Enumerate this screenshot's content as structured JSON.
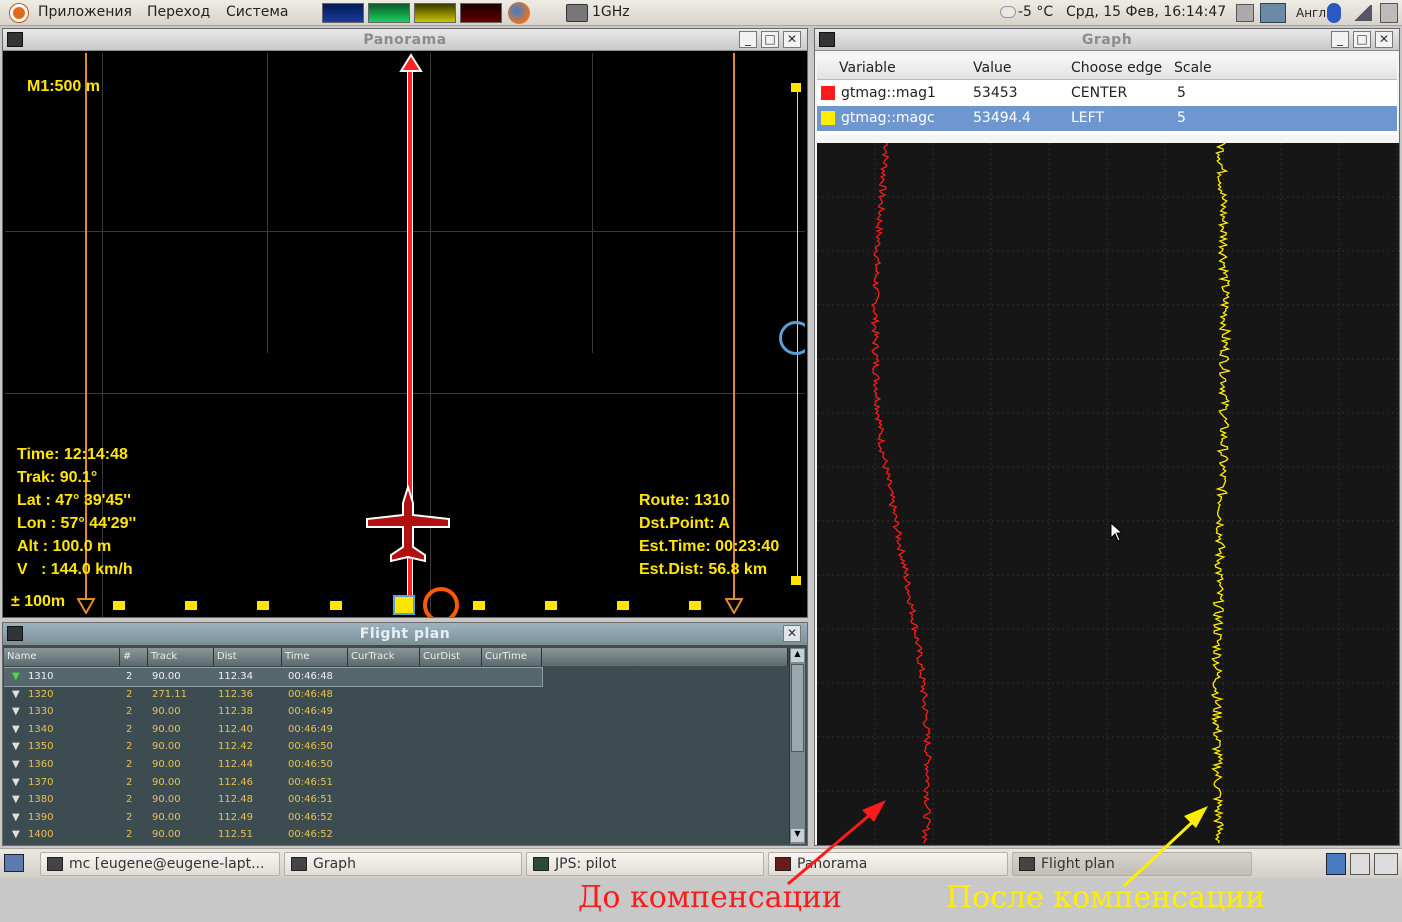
{
  "top_panel": {
    "menus": [
      "Приложения",
      "Переход",
      "Система"
    ],
    "cpu": "1GHz",
    "weather": "-5 °C",
    "clock": "Срд, 15 Фев, 16:14:47",
    "keyboard": "Англ"
  },
  "panorama": {
    "title": "Panorama",
    "scale": "M1:500 m",
    "range": "± 100m",
    "left_readout": [
      "Time: 12:14:48",
      "Trak: 90.1°",
      "Lat : 47° 39'45''",
      "Lon : 57° 44'29''",
      "Alt : 100.0 m",
      "V   : 144.0 km/h"
    ],
    "right_readout": [
      "Route: 1310",
      "Dst.Point: A",
      "Est.Time: 00:23:40",
      "Est.Dist: 56.8 km"
    ],
    "colors": {
      "hud": "#ffe600",
      "track": "#ff2020",
      "boundary": "#e08a2a"
    }
  },
  "flight_plan": {
    "title": "Flight plan",
    "columns": [
      "Name",
      "#",
      "Track",
      "Dist",
      "Time",
      "CurTrack",
      "CurDist",
      "CurTime"
    ],
    "rows": [
      [
        "1310",
        "2",
        "90.00",
        "112.34",
        "00:46:48"
      ],
      [
        "1320",
        "2",
        "271.11",
        "112.36",
        "00:46:48"
      ],
      [
        "1330",
        "2",
        "90.00",
        "112.38",
        "00:46:49"
      ],
      [
        "1340",
        "2",
        "90.00",
        "112.40",
        "00:46:49"
      ],
      [
        "1350",
        "2",
        "90.00",
        "112.42",
        "00:46:50"
      ],
      [
        "1360",
        "2",
        "90.00",
        "112.44",
        "00:46:50"
      ],
      [
        "1370",
        "2",
        "90.00",
        "112.46",
        "00:46:51"
      ],
      [
        "1380",
        "2",
        "90.00",
        "112.48",
        "00:46:51"
      ],
      [
        "1390",
        "2",
        "90.00",
        "112.49",
        "00:46:52"
      ],
      [
        "1400",
        "2",
        "90.00",
        "112.51",
        "00:46:52"
      ]
    ]
  },
  "graph": {
    "title": "Graph",
    "headers": [
      "Variable",
      "Value",
      "Choose edge",
      "Scale"
    ],
    "rows": [
      {
        "variable": "gtmag::mag1",
        "value": "53453",
        "edge": "CENTER",
        "scale": "5",
        "color": "#ff1a1a"
      },
      {
        "variable": "gtmag::magc",
        "value": "53494.4",
        "edge": "LEFT",
        "scale": "5",
        "color": "#ffee00"
      }
    ]
  },
  "taskbar": {
    "tasks": [
      "mc [eugene@eugene-lapt...",
      "Graph",
      "JPS: pilot",
      "Panorama",
      "Flight plan"
    ]
  },
  "annotations": {
    "before": "До компенсации",
    "after": "После компенсации"
  }
}
